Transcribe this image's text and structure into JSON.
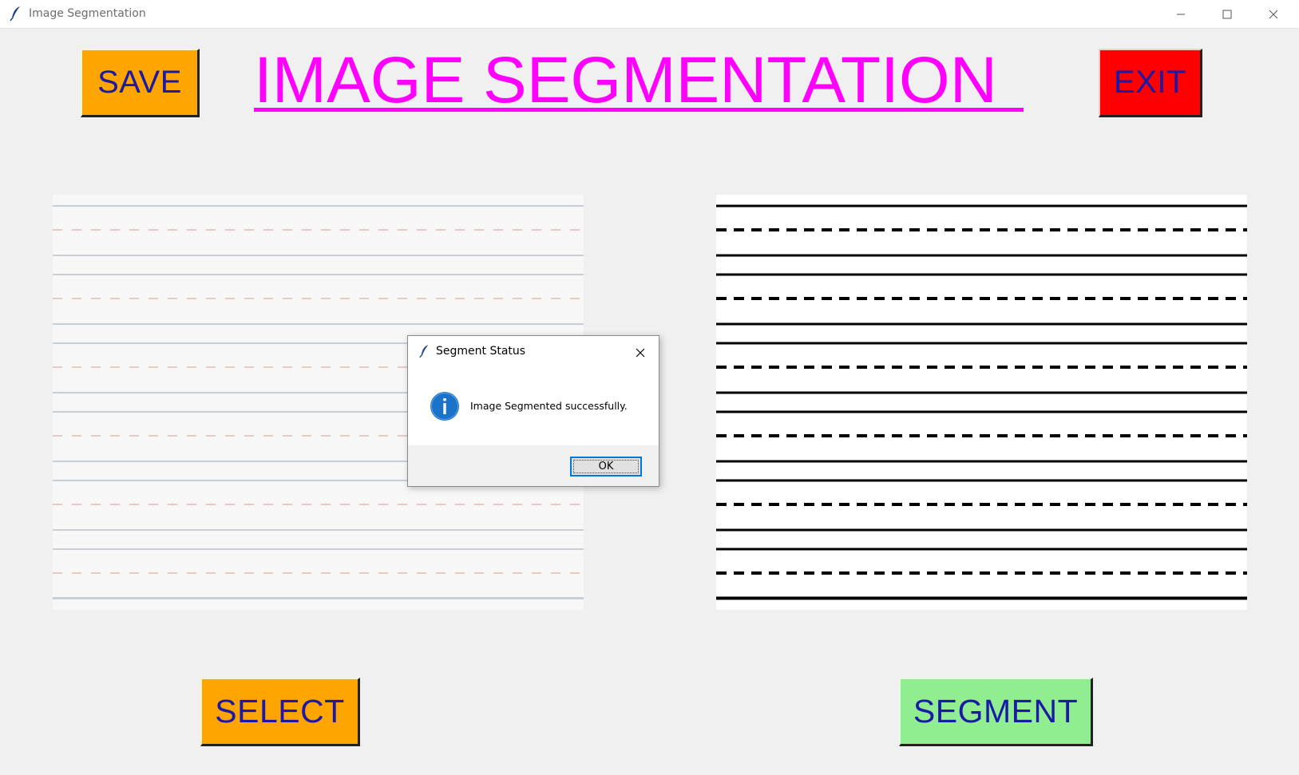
{
  "window": {
    "title": "Image Segmentation",
    "icon": "feather-icon"
  },
  "header": {
    "title": "IMAGE SEGMENTATION",
    "title_color": "#ff00ff",
    "save_label": "SAVE",
    "exit_label": "EXIT"
  },
  "footer": {
    "select_label": "SELECT",
    "segment_label": "SEGMENT"
  },
  "colors": {
    "save": "#ffa500",
    "exit": "#ff0000",
    "select": "#ffa500",
    "segment": "#90ee90",
    "button_text": "#1a1aa6"
  },
  "dialog": {
    "title": "Segment Status",
    "message": "Image Segmented successfully.",
    "ok_label": "OK",
    "icon": "info-icon"
  }
}
